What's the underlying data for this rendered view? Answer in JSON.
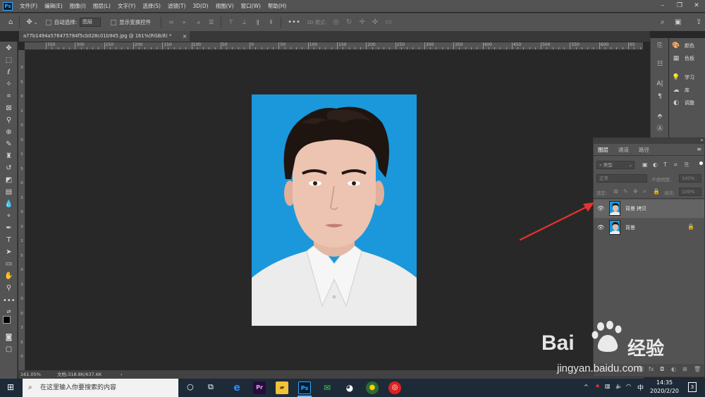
{
  "menu": {
    "items": [
      "文件(F)",
      "编辑(E)",
      "图像(I)",
      "图层(L)",
      "文字(Y)",
      "选择(S)",
      "滤镜(T)",
      "3D(D)",
      "视图(V)",
      "窗口(W)",
      "帮助(H)"
    ]
  },
  "options": {
    "auto_select_label": "自动选择:",
    "auto_select_value": "图层",
    "show_transform_label": "显示变换控件",
    "mode_3d_label": "3D 模式:"
  },
  "document": {
    "tab_title": "a77b1494a576475784f5cb028c01b945.jpg @ 161%(RGB/8) *",
    "zoom": "161.05%",
    "doc_info": "文档:318.8K/637.6K"
  },
  "rulers": {
    "top": [
      "350",
      "300",
      "250",
      "200",
      "150",
      "100",
      "50",
      "0",
      "50",
      "100",
      "150",
      "200",
      "250",
      "300",
      "350",
      "400",
      "450",
      "500",
      "550",
      "600",
      "65"
    ],
    "left": [
      "0",
      "5",
      "0",
      "1",
      "0",
      "0",
      "1",
      "5",
      "0",
      "2",
      "0",
      "0",
      "2",
      "5",
      "0",
      "3",
      "0",
      "0",
      "3",
      "5",
      "0"
    ]
  },
  "panels": {
    "color_label": "颜色",
    "swatches_label": "色板",
    "learn_label": "学习",
    "library_label": "库",
    "adjust_label": "调整"
  },
  "layers_panel": {
    "tabs": [
      "图层",
      "通道",
      "路径"
    ],
    "filter_kind": "类型",
    "blend_mode": "正常",
    "opacity_label": "不透明度:",
    "opacity_value": "100%",
    "lock_label": "锁定:",
    "fill_label": "填充:",
    "fill_value": "100%",
    "layers": [
      {
        "name": "背景 拷贝",
        "selected": true,
        "locked": false
      },
      {
        "name": "背景",
        "selected": false,
        "locked": true
      }
    ]
  },
  "taskbar": {
    "search_placeholder": "在这里输入你要搜索的内容",
    "ime": "中",
    "time": "14:35",
    "date": "2020/2/20",
    "notifications": "3"
  },
  "watermark": {
    "brand": "Bai",
    "brand2": "经验",
    "url": "jingyan.baidu.com"
  },
  "colors": {
    "photo_bg": "#1b98db",
    "arrow": "#e8322d",
    "ps_ui": "#535353",
    "canvas": "#282828"
  }
}
